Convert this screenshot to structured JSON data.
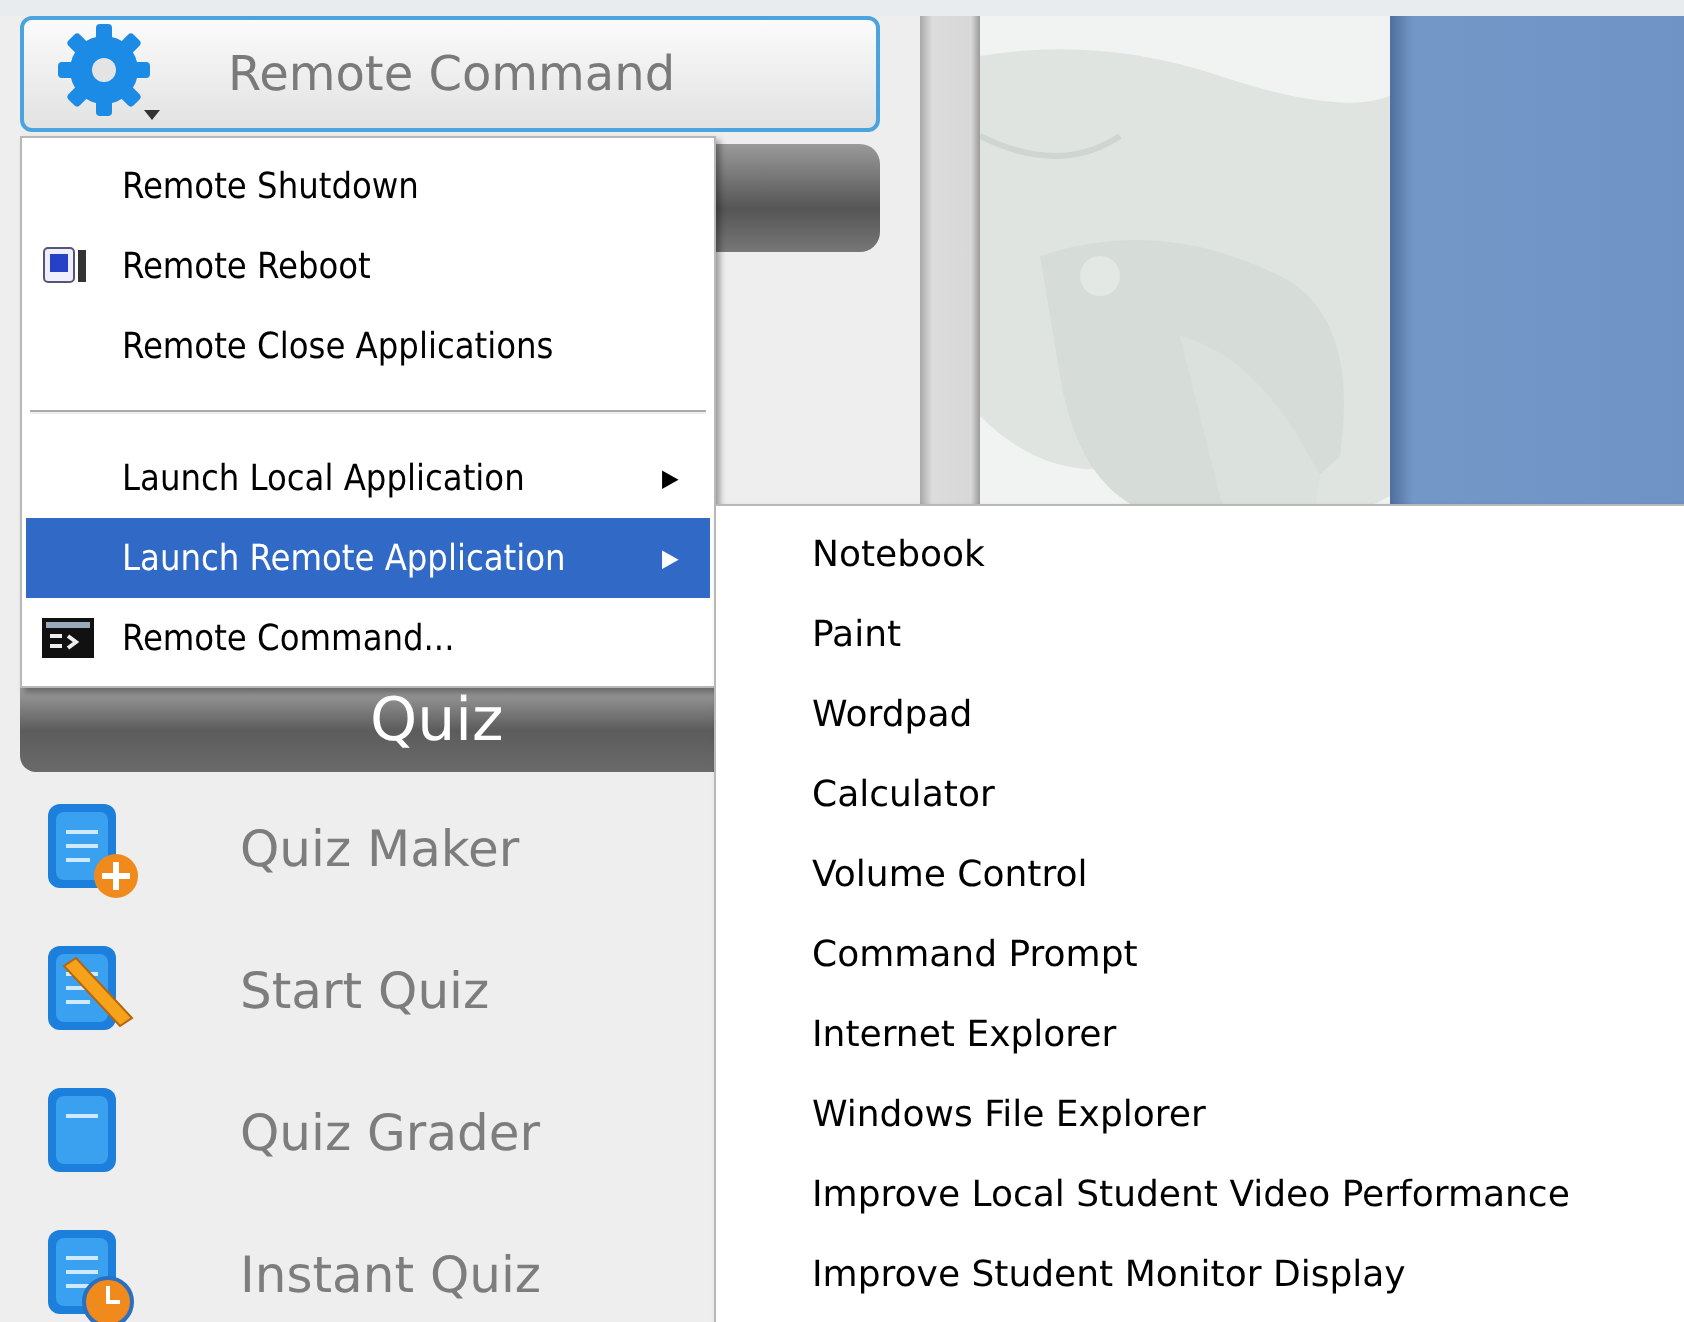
{
  "command_button": {
    "label": "Remote Command"
  },
  "menu": [
    {
      "kind": "item",
      "label": "Remote Shutdown",
      "selected": false
    },
    {
      "kind": "reboot",
      "label": "Remote Reboot",
      "selected": false
    },
    {
      "kind": "item",
      "label": "Remote Close Applications",
      "selected": false
    },
    {
      "kind": "separator"
    },
    {
      "kind": "submenu",
      "label": "Launch Local Application",
      "arrow": "▶",
      "selected": false
    },
    {
      "kind": "submenu",
      "label": "Launch Remote Application",
      "arrow": "▶",
      "selected": true
    },
    {
      "kind": "console",
      "label": "Remote Command...",
      "selected": false
    }
  ],
  "submenu": [
    "Notebook",
    "Paint",
    "Wordpad",
    "Calculator",
    "Volume Control",
    "Command Prompt",
    "Internet Explorer",
    "Windows File Explorer",
    "Improve Local Student Video Performance",
    "Improve Student Monitor Display"
  ],
  "quiz": {
    "title": "Quiz",
    "items": [
      {
        "label": "Quiz Maker",
        "kind": "maker"
      },
      {
        "label": "Start Quiz",
        "kind": "start"
      },
      {
        "label": "Quiz Grader",
        "kind": "grader"
      },
      {
        "label": "Instant Quiz",
        "kind": "instant"
      }
    ]
  }
}
